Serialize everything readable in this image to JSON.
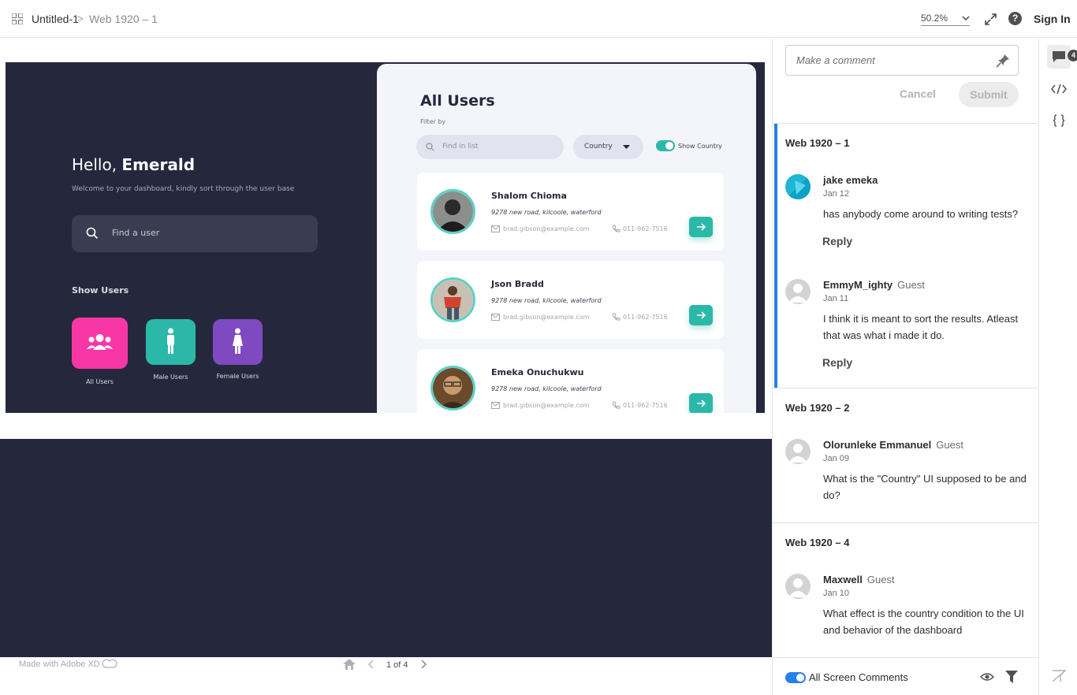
{
  "topbar": {
    "crumb_file": "Untitled-1",
    "crumb_sep": ">",
    "crumb_artboard": "Web 1920 – 1",
    "zoom": "50.2%",
    "sign_in": "Sign In"
  },
  "artboard": {
    "greeting_prefix": "Hello, ",
    "greeting_name": "Emerald",
    "welcome": "Welcome to your dashboard, kindly sort through the user base",
    "find_user_placeholder": "Find a user",
    "show_users": "Show Users",
    "categories": [
      {
        "label": "All Users",
        "color": "#f837a6"
      },
      {
        "label": "Male Users",
        "color": "#2bb8a9"
      },
      {
        "label": "Female Users",
        "color": "#7e49c1"
      }
    ],
    "panel": {
      "title": "All Users",
      "filter_by": "Filter by",
      "find_in_list": "Find in list",
      "country": "Country",
      "show_country": "Show Country"
    },
    "users": [
      {
        "name": "Shalom Chioma",
        "address": "9278 new road, kilcoole, waterford",
        "email": "brad.gibson@example.com",
        "phone": "011-962-7516"
      },
      {
        "name": "Json Bradd",
        "address": "9278 new road, kilcoole, waterford",
        "email": "brad.gibson@example.com",
        "phone": "011-962-7516"
      },
      {
        "name": "Emeka Onuchukwu",
        "address": "9278 new road, kilcoole, waterford",
        "email": "brad.gibson@example.com",
        "phone": "011-962-7516"
      }
    ]
  },
  "footer": {
    "made_with": "Made with Adobe XD",
    "pager": "1 of 4"
  },
  "comments": {
    "input_placeholder": "Make a comment",
    "cancel": "Cancel",
    "submit": "Submit",
    "groups": [
      {
        "title": "Web 1920 – 1",
        "items": [
          {
            "author": "jake emeka",
            "guest": "",
            "date": "Jan 12",
            "text": "has anybody come around to writing tests?",
            "reply": "Reply"
          },
          {
            "author": "EmmyM_ighty",
            "guest": "Guest",
            "date": "Jan 11",
            "text": "I think it is meant to sort the results. Atleast that was what i made it do.",
            "reply": "Reply"
          }
        ]
      },
      {
        "title": "Web 1920 – 2",
        "items": [
          {
            "author": "Olorunleke Emmanuel",
            "guest": "Guest",
            "date": "Jan 09",
            "text": "What is the \"Country\" UI supposed to be and do?"
          }
        ]
      },
      {
        "title": "Web 1920 – 4",
        "items": [
          {
            "author": "Maxwell",
            "guest": "Guest",
            "date": "Jan 10",
            "text": "What effect is the country condition to the UI and behavior of the dashboard"
          }
        ]
      }
    ],
    "all_screen_comments": "All Screen Comments"
  },
  "rail": {
    "comment_count": "4"
  },
  "colors": {
    "dark": "#25283d",
    "teal": "#2bb8a9",
    "pink": "#f837a6",
    "purple": "#7e49c1",
    "accent_blue": "#2680eb"
  }
}
